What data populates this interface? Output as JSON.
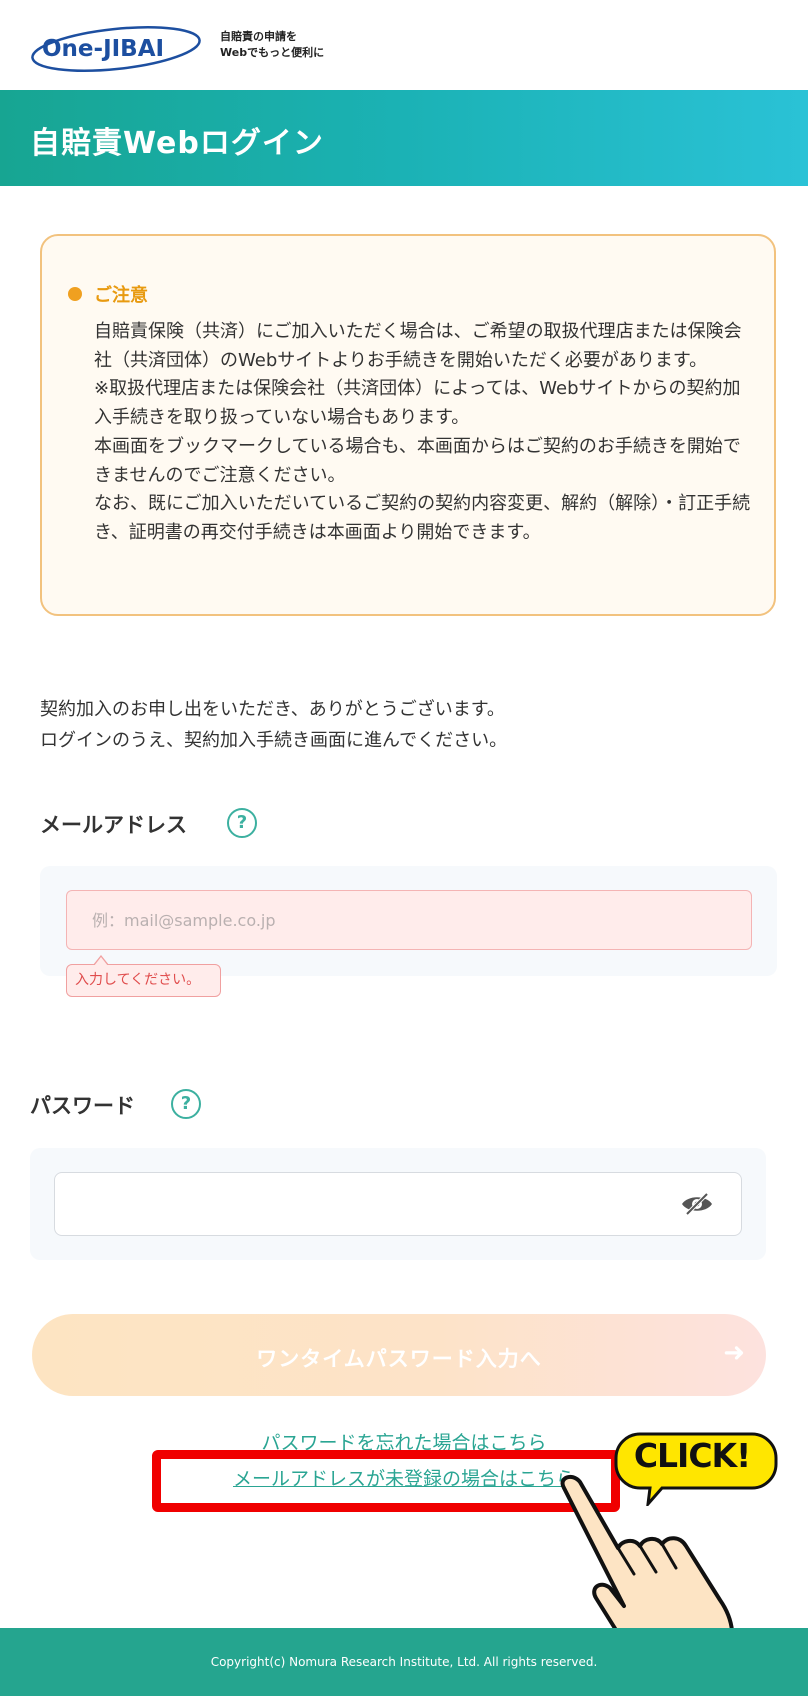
{
  "header": {
    "logo_text": "One-JIBAI",
    "tagline_line1": "自賠責の申請を",
    "tagline_line2": "Webでもっと便利に"
  },
  "page_title": "自賠責Webログイン",
  "notice": {
    "title": "ご注意",
    "body": "自賠責保険（共済）にご加入いただく場合は、ご希望の取扱代理店または保険会社（共済団体）のWebサイトよりお手続きを開始いただく必要があります。\n※取扱代理店または保険会社（共済団体）によっては、Webサイトからの契約加入手続きを取り扱っていない場合もあります。\n本画面をブックマークしている場合も、本画面からはご契約のお手続きを開始できませんのでご注意ください。\nなお、既にご加入いただいているご契約の契約内容変更、解約（解除）・訂正手続き、証明書の再交付手続きは本画面より開始できます。"
  },
  "intro": "契約加入のお申し出をいただき、ありがとうございます。\nログインのうえ、契約加入手続き画面に進んでください。",
  "email": {
    "label": "メールアドレス",
    "placeholder": "例：mail@sample.co.jp",
    "value": "",
    "error": "入力してください。"
  },
  "password": {
    "label": "パスワード",
    "value": ""
  },
  "help_glyph": "?",
  "otp_button": {
    "label": "ワンタイムパスワード入力へ",
    "arrow": "➜",
    "enabled": false
  },
  "links": {
    "forgot_password": "パスワードを忘れた場合はこちら",
    "unregistered_email": "メールアドレスが未登録の場合はこちら"
  },
  "annotation": {
    "callout": "CLICK!",
    "highlight_color": "#f00000"
  },
  "footer": {
    "copyright": "Copyright(c) Nomura Research Institute, Ltd. All rights reserved."
  },
  "colors": {
    "brand_teal": "#1bb2b5",
    "notice_orange": "#e89a10",
    "link": "#2aa593",
    "error": "#e04c4c",
    "footer": "#25a58f"
  },
  "icons": {
    "help": "question-circle-icon",
    "visibility": "eye-off-icon",
    "arrow": "arrow-right-icon",
    "notice": "bullet-dot-icon"
  }
}
